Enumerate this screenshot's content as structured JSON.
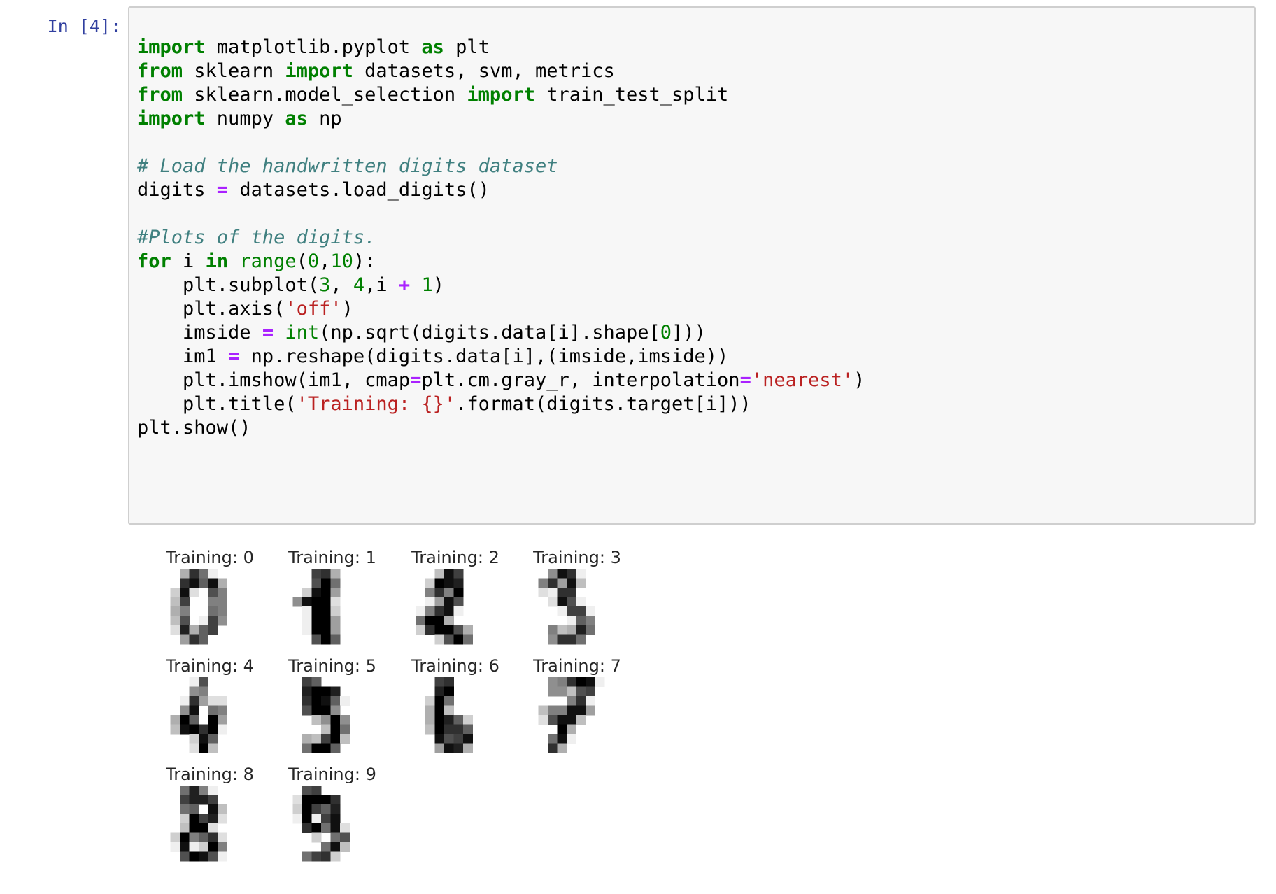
{
  "cell": {
    "prompt": "In [4]:",
    "code_lines": [
      [
        [
          "kw",
          "import"
        ],
        [
          "t",
          " matplotlib.pyplot "
        ],
        [
          "kw",
          "as"
        ],
        [
          "t",
          " plt"
        ]
      ],
      [
        [
          "kw",
          "from"
        ],
        [
          "t",
          " sklearn "
        ],
        [
          "kw",
          "import"
        ],
        [
          "t",
          " datasets, svm, metrics"
        ]
      ],
      [
        [
          "kw",
          "from"
        ],
        [
          "t",
          " sklearn.model_selection "
        ],
        [
          "kw",
          "import"
        ],
        [
          "t",
          " train_test_split"
        ]
      ],
      [
        [
          "kw",
          "import"
        ],
        [
          "t",
          " numpy "
        ],
        [
          "kw",
          "as"
        ],
        [
          "t",
          " np"
        ]
      ],
      [],
      [
        [
          "cm",
          "# Load the handwritten digits dataset"
        ]
      ],
      [
        [
          "t",
          "digits "
        ],
        [
          "op",
          "="
        ],
        [
          "t",
          " datasets.load_digits()"
        ]
      ],
      [],
      [
        [
          "cm",
          "#Plots of the digits."
        ]
      ],
      [
        [
          "kw",
          "for"
        ],
        [
          "t",
          " i "
        ],
        [
          "kw",
          "in"
        ],
        [
          "t",
          " "
        ],
        [
          "bi",
          "range"
        ],
        [
          "t",
          "("
        ],
        [
          "num",
          "0"
        ],
        [
          "t",
          ","
        ],
        [
          "num",
          "10"
        ],
        [
          "t",
          "):"
        ]
      ],
      [
        [
          "t",
          "    plt.subplot("
        ],
        [
          "num",
          "3"
        ],
        [
          "t",
          ", "
        ],
        [
          "num",
          "4"
        ],
        [
          "t",
          ",i "
        ],
        [
          "op",
          "+"
        ],
        [
          "t",
          " "
        ],
        [
          "num",
          "1"
        ],
        [
          "t",
          ")"
        ]
      ],
      [
        [
          "t",
          "    plt.axis("
        ],
        [
          "str",
          "'off'"
        ],
        [
          "t",
          ")"
        ]
      ],
      [
        [
          "t",
          "    imside "
        ],
        [
          "op",
          "="
        ],
        [
          "t",
          " "
        ],
        [
          "bi",
          "int"
        ],
        [
          "t",
          "(np.sqrt(digits.data[i].shape["
        ],
        [
          "num",
          "0"
        ],
        [
          "t",
          "]))"
        ]
      ],
      [
        [
          "t",
          "    im1 "
        ],
        [
          "op",
          "="
        ],
        [
          "t",
          " np.reshape(digits.data[i],(imside,imside))"
        ]
      ],
      [
        [
          "t",
          "    plt.imshow(im1, cmap"
        ],
        [
          "op",
          "="
        ],
        [
          "t",
          "plt.cm.gray_r, interpolation"
        ],
        [
          "op",
          "="
        ],
        [
          "str",
          "'nearest'"
        ],
        [
          "t",
          ")"
        ]
      ],
      [
        [
          "t",
          "    plt.title("
        ],
        [
          "str",
          "'Training: {}'"
        ],
        [
          "t",
          ".format(digits.target[i]))"
        ]
      ],
      [
        [
          "t",
          "plt.show()"
        ]
      ]
    ]
  },
  "output": {
    "subplot_titles": [
      "Training: 0",
      "Training: 1",
      "Training: 2",
      "Training: 3",
      "Training: 4",
      "Training: 5",
      "Training: 6",
      "Training: 7",
      "Training: 8",
      "Training: 9"
    ],
    "colormap": "gray_r",
    "digit_images": [
      [
        [
          0,
          0,
          5,
          13,
          9,
          1,
          0,
          0
        ],
        [
          0,
          0,
          13,
          15,
          10,
          15,
          5,
          0
        ],
        [
          0,
          3,
          15,
          2,
          0,
          11,
          8,
          0
        ],
        [
          0,
          4,
          12,
          0,
          0,
          8,
          8,
          0
        ],
        [
          0,
          5,
          8,
          0,
          0,
          9,
          8,
          0
        ],
        [
          0,
          4,
          11,
          0,
          1,
          12,
          7,
          0
        ],
        [
          0,
          2,
          14,
          5,
          10,
          12,
          0,
          0
        ],
        [
          0,
          0,
          6,
          13,
          10,
          0,
          0,
          0
        ]
      ],
      [
        [
          0,
          0,
          0,
          12,
          13,
          5,
          0,
          0
        ],
        [
          0,
          0,
          0,
          11,
          16,
          9,
          0,
          0
        ],
        [
          0,
          0,
          3,
          15,
          16,
          6,
          0,
          0
        ],
        [
          0,
          7,
          15,
          16,
          16,
          2,
          0,
          0
        ],
        [
          0,
          0,
          1,
          16,
          16,
          3,
          0,
          0
        ],
        [
          0,
          0,
          1,
          16,
          16,
          6,
          0,
          0
        ],
        [
          0,
          0,
          1,
          16,
          16,
          6,
          0,
          0
        ],
        [
          0,
          0,
          0,
          11,
          16,
          10,
          0,
          0
        ]
      ],
      [
        [
          0,
          0,
          0,
          4,
          15,
          12,
          0,
          0
        ],
        [
          0,
          0,
          3,
          16,
          15,
          14,
          0,
          0
        ],
        [
          0,
          0,
          8,
          13,
          8,
          16,
          0,
          0
        ],
        [
          0,
          0,
          1,
          6,
          15,
          11,
          0,
          0
        ],
        [
          0,
          1,
          8,
          13,
          15,
          1,
          0,
          0
        ],
        [
          0,
          9,
          16,
          16,
          5,
          0,
          0,
          0
        ],
        [
          0,
          3,
          13,
          16,
          16,
          11,
          5,
          0
        ],
        [
          0,
          0,
          0,
          3,
          11,
          16,
          9,
          0
        ]
      ],
      [
        [
          0,
          0,
          7,
          15,
          13,
          1,
          0,
          0
        ],
        [
          0,
          8,
          13,
          6,
          15,
          4,
          0,
          0
        ],
        [
          0,
          2,
          1,
          13,
          13,
          0,
          0,
          0
        ],
        [
          0,
          0,
          2,
          15,
          11,
          1,
          0,
          0
        ],
        [
          0,
          0,
          0,
          1,
          12,
          12,
          1,
          0
        ],
        [
          0,
          0,
          0,
          0,
          1,
          10,
          8,
          0
        ],
        [
          0,
          0,
          8,
          4,
          5,
          14,
          9,
          0
        ],
        [
          0,
          0,
          7,
          13,
          13,
          9,
          0,
          0
        ]
      ],
      [
        [
          0,
          0,
          0,
          1,
          11,
          0,
          0,
          0
        ],
        [
          0,
          0,
          0,
          7,
          8,
          0,
          0,
          0
        ],
        [
          0,
          0,
          1,
          13,
          6,
          2,
          2,
          0
        ],
        [
          0,
          0,
          7,
          15,
          0,
          9,
          8,
          0
        ],
        [
          0,
          5,
          16,
          10,
          0,
          16,
          6,
          0
        ],
        [
          0,
          4,
          15,
          16,
          13,
          16,
          1,
          0
        ],
        [
          0,
          0,
          0,
          3,
          15,
          10,
          0,
          0
        ],
        [
          0,
          0,
          0,
          2,
          16,
          4,
          0,
          0
        ]
      ],
      [
        [
          0,
          0,
          12,
          10,
          0,
          0,
          0,
          0
        ],
        [
          0,
          0,
          14,
          16,
          16,
          14,
          0,
          0
        ],
        [
          0,
          0,
          13,
          16,
          15,
          10,
          1,
          0
        ],
        [
          0,
          0,
          11,
          16,
          16,
          7,
          0,
          0
        ],
        [
          0,
          0,
          0,
          4,
          7,
          16,
          7,
          0
        ],
        [
          0,
          0,
          0,
          0,
          4,
          16,
          9,
          0
        ],
        [
          0,
          0,
          5,
          4,
          12,
          16,
          4,
          0
        ],
        [
          0,
          0,
          9,
          16,
          16,
          10,
          0,
          0
        ]
      ],
      [
        [
          0,
          0,
          0,
          12,
          13,
          0,
          0,
          0
        ],
        [
          0,
          0,
          0,
          14,
          16,
          0,
          0,
          0
        ],
        [
          0,
          0,
          3,
          16,
          9,
          0,
          0,
          0
        ],
        [
          0,
          0,
          5,
          16,
          4,
          0,
          0,
          0
        ],
        [
          0,
          0,
          5,
          16,
          14,
          10,
          3,
          0
        ],
        [
          0,
          0,
          4,
          16,
          13,
          13,
          10,
          0
        ],
        [
          0,
          0,
          0,
          15,
          11,
          12,
          15,
          0
        ],
        [
          0,
          0,
          0,
          6,
          15,
          14,
          5,
          0
        ]
      ],
      [
        [
          0,
          0,
          7,
          8,
          13,
          16,
          15,
          1
        ],
        [
          0,
          0,
          7,
          7,
          4,
          11,
          12,
          0
        ],
        [
          0,
          0,
          0,
          0,
          8,
          13,
          1,
          0
        ],
        [
          0,
          4,
          8,
          8,
          15,
          15,
          6,
          0
        ],
        [
          0,
          2,
          11,
          15,
          15,
          4,
          0,
          0
        ],
        [
          0,
          0,
          0,
          16,
          5,
          0,
          0,
          0
        ],
        [
          0,
          0,
          9,
          15,
          1,
          0,
          0,
          0
        ],
        [
          0,
          0,
          13,
          5,
          0,
          0,
          0,
          0
        ]
      ],
      [
        [
          0,
          0,
          9,
          14,
          8,
          1,
          0,
          0
        ],
        [
          0,
          0,
          12,
          14,
          14,
          12,
          0,
          0
        ],
        [
          0,
          0,
          9,
          10,
          0,
          15,
          4,
          0
        ],
        [
          0,
          0,
          3,
          16,
          12,
          14,
          2,
          0
        ],
        [
          0,
          0,
          4,
          16,
          16,
          2,
          0,
          0
        ],
        [
          0,
          3,
          16,
          8,
          10,
          13,
          2,
          0
        ],
        [
          0,
          1,
          15,
          1,
          3,
          16,
          8,
          0
        ],
        [
          0,
          0,
          11,
          16,
          15,
          11,
          1,
          0
        ]
      ],
      [
        [
          0,
          0,
          11,
          12,
          0,
          0,
          0,
          0
        ],
        [
          0,
          2,
          16,
          16,
          16,
          13,
          0,
          0
        ],
        [
          0,
          3,
          16,
          12,
          10,
          14,
          0,
          0
        ],
        [
          0,
          1,
          16,
          1,
          12,
          15,
          0,
          0
        ],
        [
          0,
          0,
          13,
          16,
          9,
          15,
          2,
          0
        ],
        [
          0,
          0,
          0,
          3,
          0,
          9,
          11,
          0
        ],
        [
          0,
          0,
          0,
          0,
          9,
          15,
          4,
          0
        ],
        [
          0,
          0,
          9,
          12,
          13,
          3,
          0,
          0
        ]
      ]
    ]
  }
}
